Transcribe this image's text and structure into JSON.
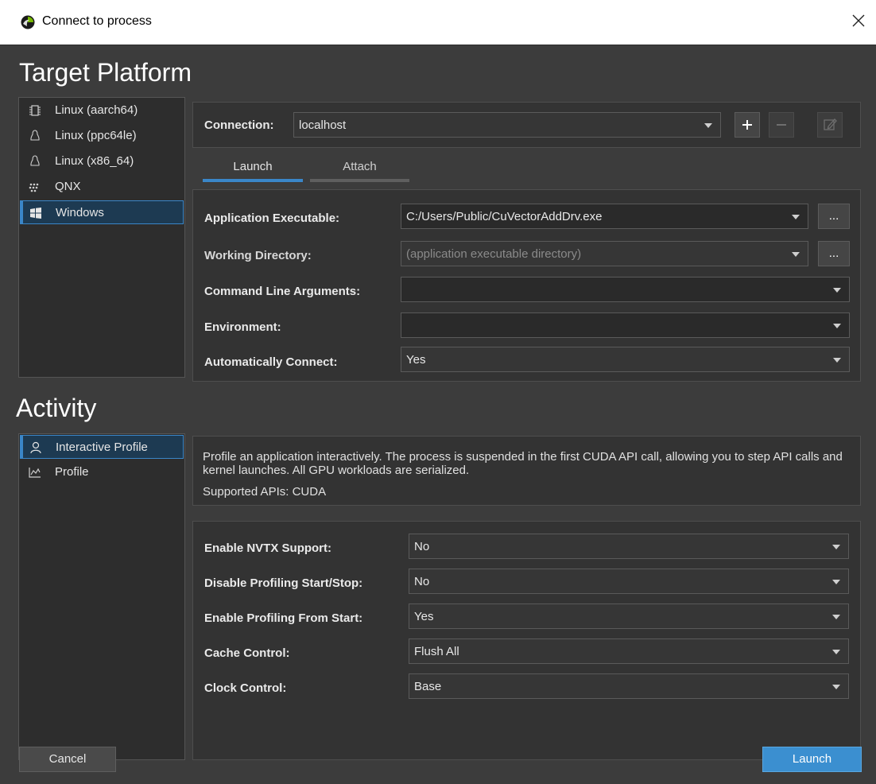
{
  "window": {
    "title": "Connect to process"
  },
  "target_platform": {
    "heading": "Target Platform",
    "platforms": [
      {
        "label": "Linux (aarch64)",
        "icon": "chip-icon"
      },
      {
        "label": "Linux (ppc64le)",
        "icon": "tux-icon"
      },
      {
        "label": "Linux (x86_64)",
        "icon": "tux-icon"
      },
      {
        "label": "QNX",
        "icon": "qnx-icon"
      },
      {
        "label": "Windows",
        "icon": "windows-icon",
        "selected": true
      }
    ]
  },
  "connection": {
    "label": "Connection:",
    "value": "localhost",
    "add_label": "+",
    "remove_label": "−"
  },
  "tabs": [
    {
      "label": "Launch",
      "active": true
    },
    {
      "label": "Attach",
      "active": false
    }
  ],
  "launch_form": {
    "app_exe": {
      "label": "Application Executable:",
      "value": "C:/Users/Public/CuVectorAddDrv.exe",
      "browse": "..."
    },
    "working_dir": {
      "label": "Working Directory:",
      "placeholder": "(application executable directory)",
      "browse": "..."
    },
    "cmd_args": {
      "label": "Command Line Arguments:",
      "value": ""
    },
    "environment": {
      "label": "Environment:",
      "value": ""
    },
    "auto_connect": {
      "label": "Automatically Connect:",
      "value": "Yes"
    }
  },
  "activity": {
    "heading": "Activity",
    "items": [
      {
        "label": "Interactive Profile",
        "icon": "interactive-profile-icon",
        "selected": true
      },
      {
        "label": "Profile",
        "icon": "profile-chart-icon",
        "selected": false
      }
    ],
    "description": "Profile an application interactively. The process is suspended in the first CUDA API call, allowing you to step API calls and kernel launches. All GPU workloads are serialized.",
    "supported": "Supported APIs: CUDA"
  },
  "activity_options": [
    {
      "key": "nvtx",
      "label": "Enable NVTX Support:",
      "value": "No"
    },
    {
      "key": "start_stop",
      "label": "Disable Profiling Start/Stop:",
      "value": "No"
    },
    {
      "key": "from_start",
      "label": "Enable Profiling From Start:",
      "value": "Yes"
    },
    {
      "key": "cache",
      "label": "Cache Control:",
      "value": "Flush All"
    },
    {
      "key": "clock",
      "label": "Clock Control:",
      "value": "Base"
    }
  ],
  "footer": {
    "cancel": "Cancel",
    "launch": "Launch"
  },
  "colors": {
    "accent": "#3b8fd0",
    "selection": "#1d3a52",
    "tab_active": "#3a86c8",
    "tab_inactive": "#5f5f5f"
  }
}
